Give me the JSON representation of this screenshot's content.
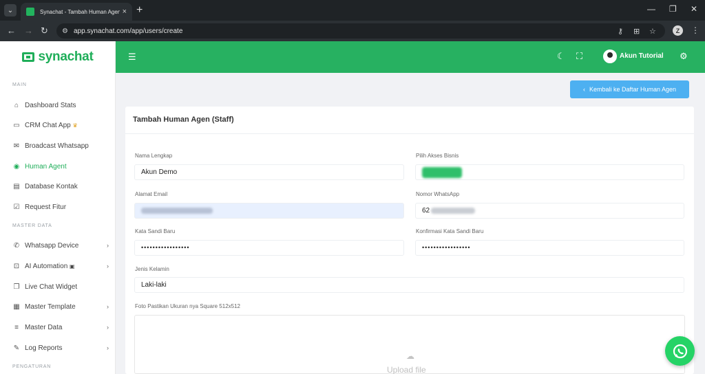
{
  "browser": {
    "tab_title": "Synachat - Tambah Human Agen",
    "tab_close": "×",
    "new_tab": "+",
    "url": "app.synachat.com/app/users/create",
    "profile_initial": "Z"
  },
  "app": {
    "logo_text": "synachat",
    "user_name": "Akun Tutorial",
    "brand_color": "#27b161"
  },
  "sidebar": {
    "section_main": "MAIN",
    "section_master": "MASTER DATA",
    "section_settings": "PENGATURAN",
    "items": [
      {
        "label": "Dashboard Stats",
        "icon": "home-icon"
      },
      {
        "label": "CRM Chat App",
        "icon": "chat-icon"
      },
      {
        "label": "Broadcast Whatsapp",
        "icon": "mail-icon"
      },
      {
        "label": "Human Agent",
        "icon": "user-circle-icon",
        "active": true
      },
      {
        "label": "Database Kontak",
        "icon": "book-icon"
      },
      {
        "label": "Request Fitur",
        "icon": "clipboard-icon"
      },
      {
        "label": "Whatsapp Device",
        "icon": "whatsapp-icon"
      },
      {
        "label": "AI Automation",
        "icon": "robot-icon"
      },
      {
        "label": "Live Chat Widget",
        "icon": "copy-icon"
      },
      {
        "label": "Master Template",
        "icon": "template-icon"
      },
      {
        "label": "Master Data",
        "icon": "list-icon"
      },
      {
        "label": "Log Reports",
        "icon": "edit-icon"
      }
    ]
  },
  "main": {
    "back_button": "Kembali ke Daftar Human Agen",
    "card_title": "Tambah Human Agen (Staff)",
    "form": {
      "name_label": "Nama Lengkap",
      "name_value": "Akun Demo",
      "business_label": "Pilih Akses Bisnis",
      "email_label": "Alamat Email",
      "phone_label": "Nomor WhatsApp",
      "phone_prefix": "62",
      "password_label": "Kata Sandi Baru",
      "password_value": "•••••••••••••••••",
      "confirm_label": "Konfirmasi Kata Sandi Baru",
      "confirm_value": "•••••••••••••••••",
      "gender_label": "Jenis Kelamin",
      "gender_value": "Laki-laki",
      "photo_label": "Foto Pastikan Ukuran nya Square 512x512",
      "upload_text": "Upload file"
    }
  }
}
